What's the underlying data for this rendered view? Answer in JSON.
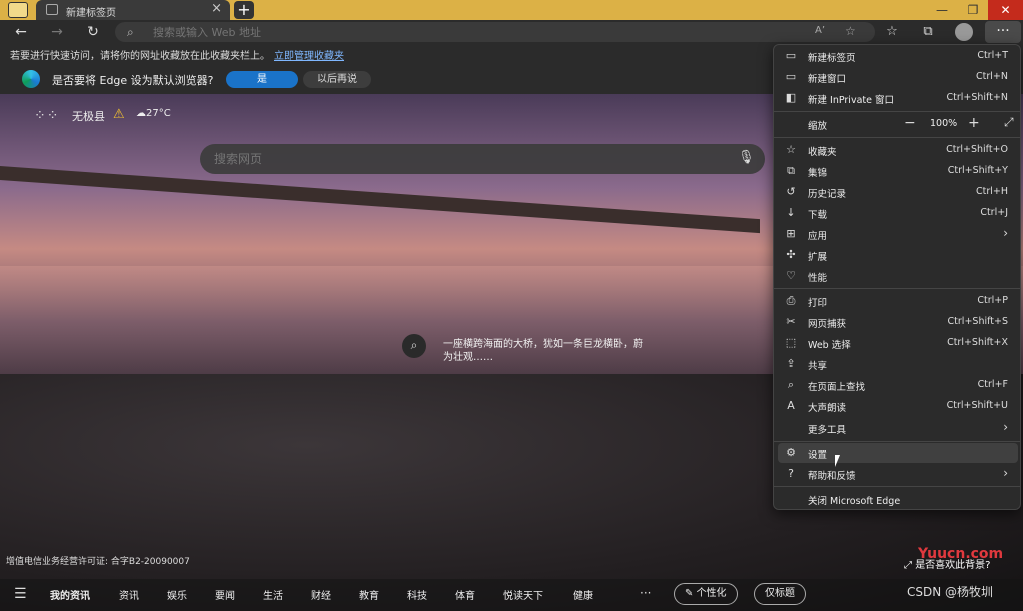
{
  "tab": {
    "title": "新建标签页",
    "close": "×"
  },
  "window": {
    "minimize": "—",
    "restore": "❐",
    "close": "✕"
  },
  "toolbar": {
    "back": "←",
    "forward": "→",
    "refresh": "↻",
    "address_placeholder": "搜索或输入 Web 地址",
    "read_aloud": "A’",
    "more": "···"
  },
  "favbar": {
    "text": "若要进行快速访问，请将你的网址收藏放在此收藏夹栏上。",
    "link": "立即管理收藏夹"
  },
  "infobar": {
    "question": "是否要将 Edge 设为默认浏览器?",
    "yes": "是",
    "later": "以后再说"
  },
  "newtab": {
    "location": "无极县",
    "temperature": "27°C",
    "search_placeholder": "搜索网页",
    "caption": "一座横跨海面的大桥，犹如一条巨龙横卧，蔚为壮观……",
    "license": "增值电信业务经营许可证: 合字B2-20090007",
    "bg_info": "是否喜欢此背景?",
    "nav": [
      "我的资讯",
      "资讯",
      "娱乐",
      "要闻",
      "生活",
      "财经",
      "教育",
      "科技",
      "体育",
      "悦读天下",
      "健康"
    ],
    "nav_more": "···",
    "personalize": "个性化",
    "headline_only": "仅标题"
  },
  "menu": {
    "items": [
      {
        "icon": "new-tab-icon",
        "label": "新建标签页",
        "shortcut": "Ctrl+T"
      },
      {
        "icon": "new-window-icon",
        "label": "新建窗口",
        "shortcut": "Ctrl+N"
      },
      {
        "icon": "inprivate-icon",
        "label": "新建 InPrivate 窗口",
        "shortcut": "Ctrl+Shift+N"
      },
      {
        "label": "缩放",
        "zoom": "100%"
      },
      {
        "icon": "favorites-icon",
        "label": "收藏夹",
        "shortcut": "Ctrl+Shift+O"
      },
      {
        "icon": "collections-icon",
        "label": "集锦",
        "shortcut": "Ctrl+Shift+Y"
      },
      {
        "icon": "history-icon",
        "label": "历史记录",
        "shortcut": "Ctrl+H"
      },
      {
        "icon": "download-icon",
        "label": "下载",
        "shortcut": "Ctrl+J"
      },
      {
        "icon": "apps-icon",
        "label": "应用",
        "arrow": "›"
      },
      {
        "icon": "extensions-icon",
        "label": "扩展"
      },
      {
        "icon": "performance-icon",
        "label": "性能"
      },
      {
        "icon": "print-icon",
        "label": "打印",
        "shortcut": "Ctrl+P"
      },
      {
        "icon": "web-capture-icon",
        "label": "网页捕获",
        "shortcut": "Ctrl+Shift+S"
      },
      {
        "icon": "web-select-icon",
        "label": "Web 选择",
        "shortcut": "Ctrl+Shift+X"
      },
      {
        "icon": "share-icon",
        "label": "共享"
      },
      {
        "icon": "find-icon",
        "label": "在页面上查找",
        "shortcut": "Ctrl+F"
      },
      {
        "icon": "read-aloud-icon",
        "label": "大声朗读",
        "shortcut": "Ctrl+Shift+U"
      },
      {
        "label": "更多工具",
        "arrow": "›"
      },
      {
        "icon": "settings-icon",
        "label": "设置"
      },
      {
        "icon": "help-icon",
        "label": "帮助和反馈",
        "arrow": "›"
      },
      {
        "label": "关闭 Microsoft Edge"
      }
    ]
  },
  "watermarks": {
    "csdn": "CSDN @杨牧圳",
    "yuucn": "Yuucn.com"
  }
}
